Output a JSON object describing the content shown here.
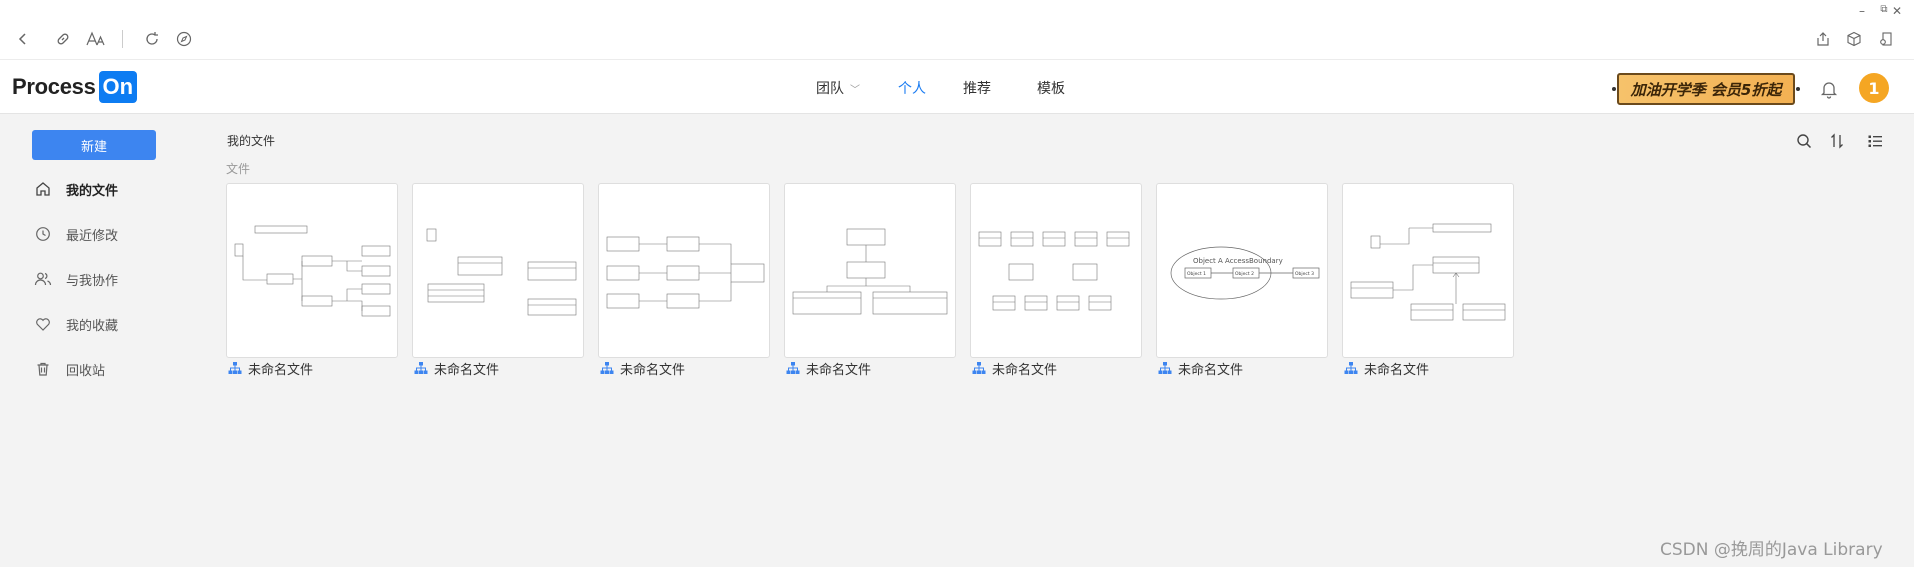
{
  "browser": {
    "toolbar_icons": [
      "back-icon",
      "link-icon",
      "font-size-icon",
      "refresh-icon",
      "compass-icon"
    ],
    "right_icons": [
      "share-icon",
      "cube-icon",
      "extension-icon"
    ],
    "window_controls": {
      "minimize": "–",
      "restore": "⧉",
      "close": "✕"
    }
  },
  "header": {
    "logo_text": "Process",
    "logo_badge": "On",
    "nav": [
      {
        "label": "团队",
        "has_dropdown": true
      },
      {
        "label": "个人",
        "active": true
      },
      {
        "label": "推荐"
      },
      {
        "label": "模板"
      }
    ],
    "promo_text": "加油开学季 会员5折起",
    "avatar_text": "1",
    "accent_color": "#1a7cf2",
    "avatar_color": "#f5a623"
  },
  "sidebar": {
    "new_button": "新建",
    "items": [
      {
        "label": "我的文件",
        "icon": "home-icon",
        "active": true
      },
      {
        "label": "最近修改",
        "icon": "clock-icon"
      },
      {
        "label": "与我协作",
        "icon": "users-icon"
      },
      {
        "label": "我的收藏",
        "icon": "heart-icon"
      },
      {
        "label": "回收站",
        "icon": "trash-icon"
      }
    ]
  },
  "main": {
    "breadcrumb": "我的文件",
    "section_label": "文件",
    "tools": [
      "search-icon",
      "sort-icon",
      "list-view-icon"
    ],
    "files": [
      {
        "name": "未命名文件"
      },
      {
        "name": "未命名文件"
      },
      {
        "name": "未命名文件"
      },
      {
        "name": "未命名文件"
      },
      {
        "name": "未命名文件"
      },
      {
        "name": "未命名文件",
        "thumb_text": "Object A AccessBoundary",
        "thumb_labels": [
          "Object 1",
          "Object 2",
          "Object 3"
        ]
      },
      {
        "name": "未命名文件"
      }
    ]
  },
  "watermark": "CSDN @挽周的Java Library"
}
